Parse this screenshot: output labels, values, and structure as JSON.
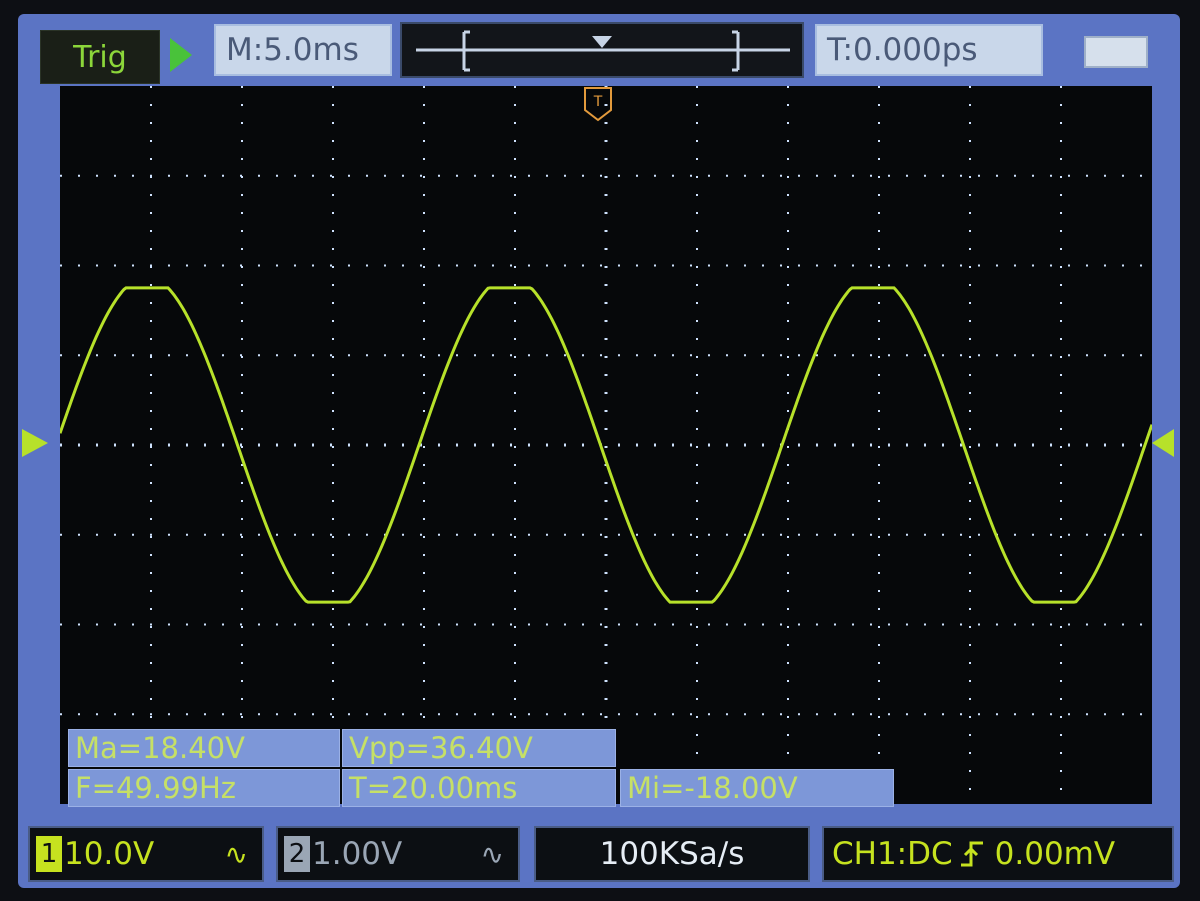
{
  "top_bar": {
    "trigger_status": "Trig",
    "timebase": "M:5.0ms",
    "trigger_position": "T:0.000ps"
  },
  "screen": {
    "trace_color": "#b7e12a",
    "grid_color": "#cfe3ff",
    "background": "#06080a"
  },
  "measurements": {
    "max": "Ma=18.40V",
    "vpp": "Vpp=36.40V",
    "frequency": "F=49.99Hz",
    "period": "T=20.00ms",
    "min": "Mi=-18.00V"
  },
  "bottom_bar": {
    "ch1": {
      "number": "1",
      "scale": "10.0V",
      "coupling": "∿"
    },
    "ch2": {
      "number": "2",
      "scale": "1.00V",
      "coupling": "∿"
    },
    "sample_rate": "100KSa/s",
    "trigger_source": "CH1:DC",
    "trigger_level": "0.00mV"
  },
  "icons": [
    "run-icon",
    "battery-icon",
    "trigger-marker-icon",
    "channel1-level-icon",
    "edge-rising-icon"
  ]
}
